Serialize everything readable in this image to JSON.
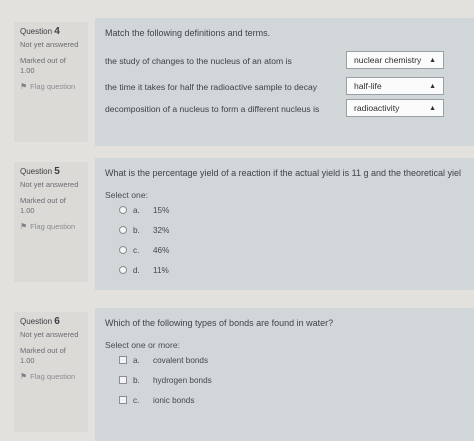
{
  "question4": {
    "number_prefix": "Question",
    "number": "4",
    "status": "Not yet answered",
    "marked": "Marked out of 1.00",
    "flag": "Flag question",
    "text": "Match the following definitions and terms.",
    "rows": [
      {
        "definition": "the study of changes to the nucleus of an atom is",
        "answer": "nuclear chemistry"
      },
      {
        "definition": "the time it takes for half the radioactive sample to decay",
        "answer": "half-life"
      },
      {
        "definition": "decomposition of a nucleus to form a different nucleus is",
        "answer": "radioactivity"
      }
    ]
  },
  "question5": {
    "number_prefix": "Question",
    "number": "5",
    "status": "Not yet answered",
    "marked": "Marked out of 1.00",
    "flag": "Flag question",
    "text": "What is the percentage yield of a reaction if the actual yield is 11 g and the theoretical yiel",
    "select_label": "Select one:",
    "options": [
      {
        "letter": "a.",
        "text": "15%"
      },
      {
        "letter": "b.",
        "text": "32%"
      },
      {
        "letter": "c.",
        "text": "46%"
      },
      {
        "letter": "d.",
        "text": "11%"
      }
    ]
  },
  "question6": {
    "number_prefix": "Question",
    "number": "6",
    "status": "Not yet answered",
    "marked": "Marked out of 1.00",
    "flag": "Flag question",
    "text": "Which of the following types of bonds are found in water?",
    "select_label": "Select one or more:",
    "options": [
      {
        "letter": "a.",
        "text": "covalent bonds"
      },
      {
        "letter": "b.",
        "text": "hydrogen bonds"
      },
      {
        "letter": "c.",
        "text": "ionic bonds"
      }
    ]
  }
}
